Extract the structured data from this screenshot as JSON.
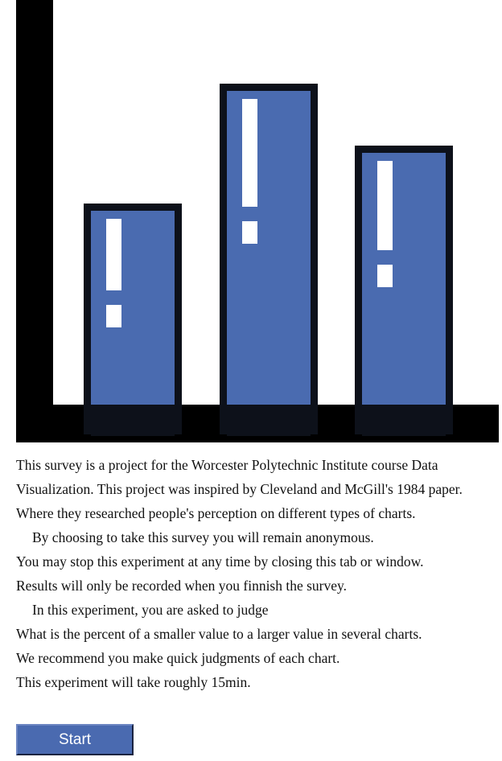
{
  "logo": {
    "icon": "bar-chart-exclamation-logo",
    "bar_fill": "#4a6bb0",
    "bar_outline": "#0d111a",
    "axis_color": "#000000",
    "mark_color": "#ffffff",
    "bar_heights": [
      0.54,
      0.81,
      0.67
    ]
  },
  "intro": {
    "paragraph_1": "This survey is a project for the Worcester Polytechnic Institute course Data Visualization. This project was inspired by Cleveland and McGill's 1984 paper. Where they researched people's perception on different types of charts.",
    "line_anonymous": "By choosing to take this survey you will remain anonymous.",
    "line_stop": "You may stop this experiment at any time by closing this tab or window.",
    "line_results": "Results will only be recorded when you finnish the survey.",
    "line_judge": "In this experiment, you are asked to judge",
    "line_question": "What is the percent of a smaller value to a larger value in several charts.",
    "line_recommend": "We recommend you make quick judgments of each chart.",
    "line_duration": "This experiment will take roughly 15min."
  },
  "start_button": {
    "label": "Start",
    "color": "#4a6ab0"
  }
}
